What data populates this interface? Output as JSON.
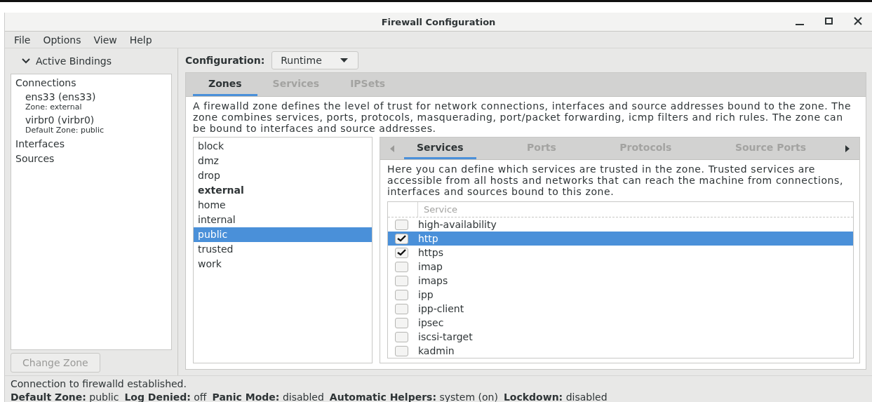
{
  "window": {
    "title": "Firewall Configuration"
  },
  "menu": [
    "File",
    "Options",
    "View",
    "Help"
  ],
  "sidebar": {
    "header": "Active Bindings",
    "expanded": true,
    "items": [
      {
        "kind": "heading",
        "label": "Connections"
      },
      {
        "kind": "binding",
        "label": "ens33 (ens33)",
        "detail": "Zone: external"
      },
      {
        "kind": "binding",
        "label": "virbr0 (virbr0)",
        "detail": "Default Zone: public"
      },
      {
        "kind": "heading",
        "label": "Interfaces"
      },
      {
        "kind": "heading",
        "label": "Sources"
      }
    ],
    "button": {
      "label": "Change Zone",
      "disabled": true
    }
  },
  "configuration": {
    "label": "Configuration:",
    "value": "Runtime"
  },
  "tabs": [
    {
      "label": "Zones",
      "selected": true
    },
    {
      "label": "Services",
      "selected": false
    },
    {
      "label": "IPSets",
      "selected": false
    }
  ],
  "zones": {
    "description": "A firewalld zone defines the level of trust for network connections, interfaces and source addresses bound to the zone. The zone combines services, ports, protocols, masquerading, port/packet forwarding, icmp filters and rich rules. The zone can be bound to interfaces and source addresses.",
    "items": [
      {
        "label": "block",
        "selected": false,
        "bold": false
      },
      {
        "label": "dmz",
        "selected": false,
        "bold": false
      },
      {
        "label": "drop",
        "selected": false,
        "bold": false
      },
      {
        "label": "external",
        "selected": false,
        "bold": true
      },
      {
        "label": "home",
        "selected": false,
        "bold": false
      },
      {
        "label": "internal",
        "selected": false,
        "bold": false
      },
      {
        "label": "public",
        "selected": true,
        "bold": false
      },
      {
        "label": "trusted",
        "selected": false,
        "bold": false
      },
      {
        "label": "work",
        "selected": false,
        "bold": false
      }
    ]
  },
  "zone_tabs": [
    {
      "label": "Services",
      "selected": true
    },
    {
      "label": "Ports",
      "selected": false
    },
    {
      "label": "Protocols",
      "selected": false
    },
    {
      "label": "Source Ports",
      "selected": false
    }
  ],
  "services": {
    "description": "Here you can define which services are trusted in the zone. Trusted services are accessible from all hosts and networks that can reach the machine from connections, interfaces and sources bound to this zone.",
    "column": "Service",
    "rows": [
      {
        "label": "high-availability",
        "checked": false,
        "selected": false
      },
      {
        "label": "http",
        "checked": true,
        "selected": true
      },
      {
        "label": "https",
        "checked": true,
        "selected": false
      },
      {
        "label": "imap",
        "checked": false,
        "selected": false
      },
      {
        "label": "imaps",
        "checked": false,
        "selected": false
      },
      {
        "label": "ipp",
        "checked": false,
        "selected": false
      },
      {
        "label": "ipp-client",
        "checked": false,
        "selected": false
      },
      {
        "label": "ipsec",
        "checked": false,
        "selected": false
      },
      {
        "label": "iscsi-target",
        "checked": false,
        "selected": false
      },
      {
        "label": "kadmin",
        "checked": false,
        "selected": false
      }
    ]
  },
  "status": {
    "message": "Connection to firewalld established.",
    "fields": [
      {
        "label": "Default Zone:",
        "value": "public"
      },
      {
        "label": "Log Denied:",
        "value": "off"
      },
      {
        "label": "Panic Mode:",
        "value": "disabled"
      },
      {
        "label": "Automatic Helpers:",
        "value": "system (on)"
      },
      {
        "label": "Lockdown:",
        "value": "disabled"
      }
    ]
  }
}
